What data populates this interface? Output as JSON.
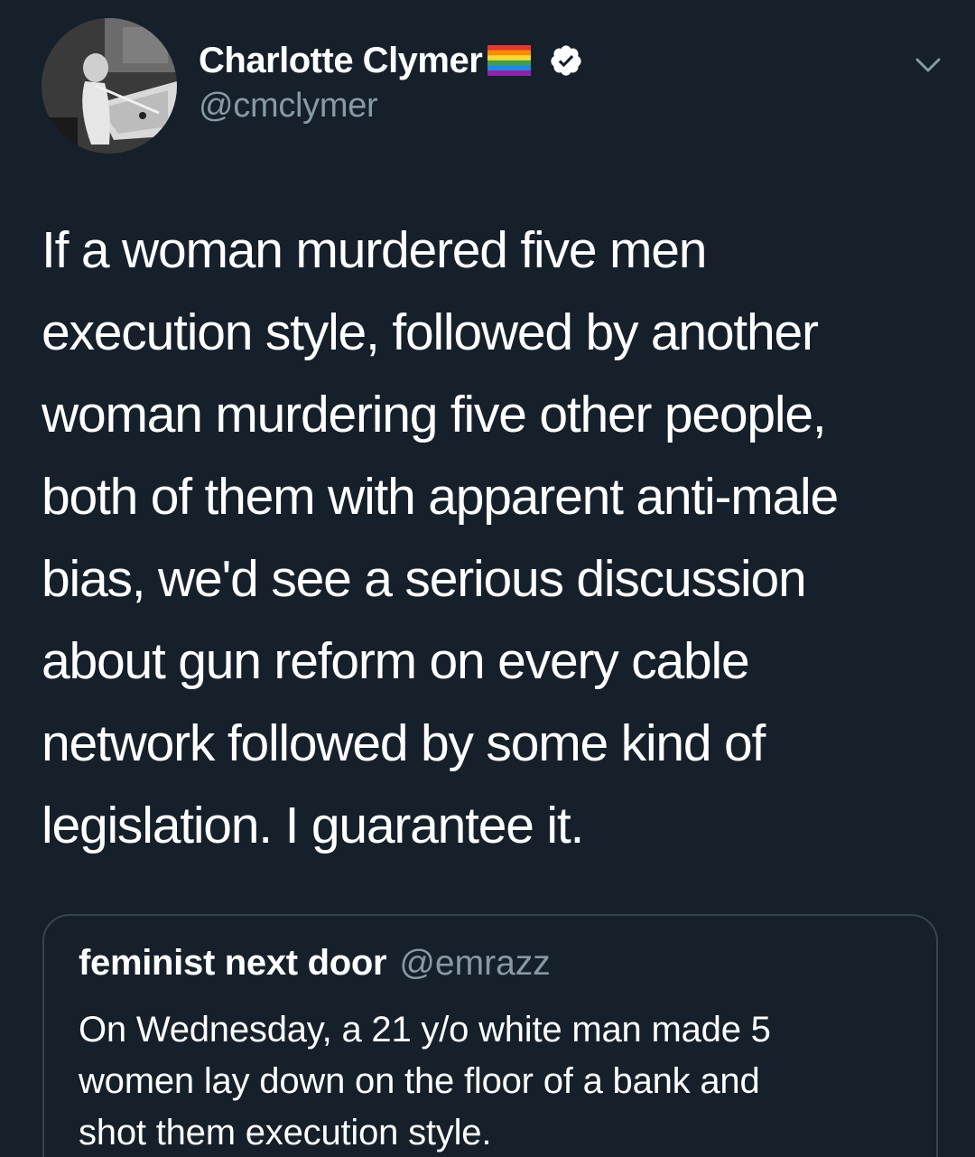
{
  "tweet": {
    "author": {
      "display_name": "Charlotte Clymer",
      "handle": "@cmclymer",
      "avatar_icon": "profile-photo",
      "flag_icon": "rainbow-flag-icon",
      "verified_icon": "verified-badge-icon"
    },
    "menu_icon": "chevron-down-icon",
    "text_lines": [
      "If a woman murdered five men",
      "execution style, followed by another",
      "woman murdering five other people,",
      "both of them with apparent anti-male",
      "bias, we'd see a serious discussion",
      "about gun reform on every cable",
      "network followed by some kind of",
      "legislation. I guarantee it."
    ],
    "quoted": {
      "display_name": "feminist next door",
      "handle": "@emrazz",
      "text_lines": [
        "On Wednesday, a 21 y/o white man made 5",
        "women lay down on the floor of a bank and",
        "shot them execution style."
      ]
    }
  },
  "colors": {
    "background": "#15202b",
    "text_primary": "#ffffff",
    "text_secondary": "#8899a6",
    "card_border": "#38444d"
  }
}
